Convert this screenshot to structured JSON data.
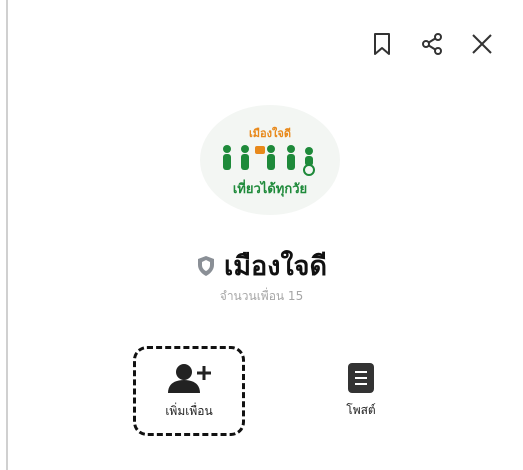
{
  "header": {
    "actions": [
      {
        "name": "bookmark",
        "icon": "bookmark-icon"
      },
      {
        "name": "share",
        "icon": "share-icon"
      },
      {
        "name": "close",
        "icon": "close-icon"
      }
    ]
  },
  "profile": {
    "logo": {
      "top_text": "เมืองใจดี",
      "bottom_text": "เที่ยวได้ทุกวัย"
    },
    "name": "เมืองใจดี",
    "badge_icon": "shield-icon",
    "friends_count": "จำนวนเพื่อน 15"
  },
  "actions": {
    "add_friend_label": "เพิ่มเพื่อน",
    "post_label": "โพสต์"
  },
  "colors": {
    "logo_green": "#1e8a3a",
    "logo_orange": "#e8891b"
  }
}
